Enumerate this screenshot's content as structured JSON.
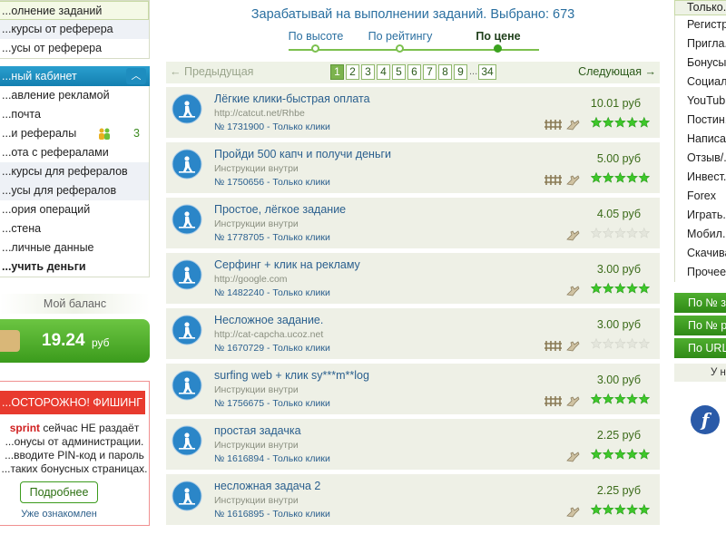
{
  "left": {
    "top_items": [
      "...олнение заданий",
      "...курсы от реферера",
      "...усы от реферера"
    ],
    "cabinet_title": "...ный кабинет",
    "cabinet_items": [
      {
        "label": "...авление рекламой"
      },
      {
        "label": "...почта"
      },
      {
        "label": "...и рефералы",
        "count": "3"
      },
      {
        "label": "...ота с рефералами"
      },
      {
        "label": "...курсы для рефералов"
      },
      {
        "label": "...усы для рефералов"
      },
      {
        "label": "...ория операций"
      },
      {
        "label": "...стена"
      },
      {
        "label": "...личные данные"
      },
      {
        "label": "...учить деньги"
      }
    ],
    "balance_title": "Мой баланс",
    "balance_amount": "19.24",
    "balance_currency": "руб",
    "phishing_title": "...ОСТОРОЖНО! ФИШИНГ",
    "phishing_brand": "sprint",
    "phishing_line1": "сейчас НЕ раздаёт",
    "phishing_line2": "...онусы от администрации.",
    "phishing_line3": "...вводите PIN-код и пароль",
    "phishing_line4": "...таких бонусных страницах.",
    "phishing_button": "Подробнее",
    "phishing_ack": "Уже ознакомлен"
  },
  "center": {
    "headline": "Зарабатывай на выполнении заданий. Выбрано: 673",
    "sorts": [
      "По высоте",
      "По рейтингу",
      "По цене"
    ],
    "active_sort": "По цене",
    "prev": "← Предыдущая",
    "next": "Следующая →",
    "pages": [
      "1",
      "2",
      "3",
      "4",
      "5",
      "6",
      "7",
      "8",
      "9",
      "...",
      "34"
    ],
    "current_page": "1",
    "tasks": [
      {
        "title": "Лёгкие клики-быстрая оплата",
        "sub": "http://catcut.net/Rhbe",
        "num": "№ 1731900 - Только клики",
        "price": "10.01 руб",
        "rating": 5,
        "fence": true
      },
      {
        "title": "Пройди 500 капч и получи деньги",
        "sub": "Инструкции внутри",
        "num": "№ 1750656 - Только клики",
        "price": "5.00 руб",
        "rating": 5,
        "fence": true
      },
      {
        "title": "Простое, лёгкое задание",
        "sub": "Инструкции внутри",
        "num": "№ 1778705 - Только клики",
        "price": "4.05 руб",
        "rating": 0,
        "fence": false
      },
      {
        "title": "Серфинг + клик на рекламу",
        "sub": "http://google.com",
        "num": "№ 1482240 - Только клики",
        "price": "3.00 руб",
        "rating": 5,
        "fence": false
      },
      {
        "title": "Несложное задание.",
        "sub": "http://cat-capcha.ucoz.net",
        "num": "№ 1670729 - Только клики",
        "price": "3.00 руб",
        "rating": 0,
        "fence": true
      },
      {
        "title": "surfing web + клик sy***m**log",
        "sub": "Инструкции внутри",
        "num": "№ 1756675 - Только клики",
        "price": "3.00 руб",
        "rating": 5,
        "fence": true
      },
      {
        "title": "простая задачка",
        "sub": "Инструкции внутри",
        "num": "№ 1616894 - Только клики",
        "price": "2.25 руб",
        "rating": 5,
        "fence": false
      },
      {
        "title": "несложная задача 2",
        "sub": "Инструкции внутри",
        "num": "№ 1616895 - Только клики",
        "price": "2.25 руб",
        "rating": 5,
        "fence": false
      }
    ]
  },
  "right": {
    "head": "Только...",
    "items": [
      "Регистр...",
      "Пригла...",
      "Бонусы...",
      "Социал...",
      "YouTub...",
      "Постин...",
      "Написа...",
      "Отзыв/...",
      "Инвест...",
      "Forex",
      "Играть...",
      "Мобил...",
      "Скачива...",
      "Прочее..."
    ],
    "buttons": [
      "По № з...",
      "По № р...",
      "По URL..."
    ],
    "uh": "У н...",
    "fb": "f"
  },
  "colors": {
    "accent_green": "#3ba21f",
    "link_blue": "#2a5f8e",
    "danger_red": "#e83a2e"
  }
}
